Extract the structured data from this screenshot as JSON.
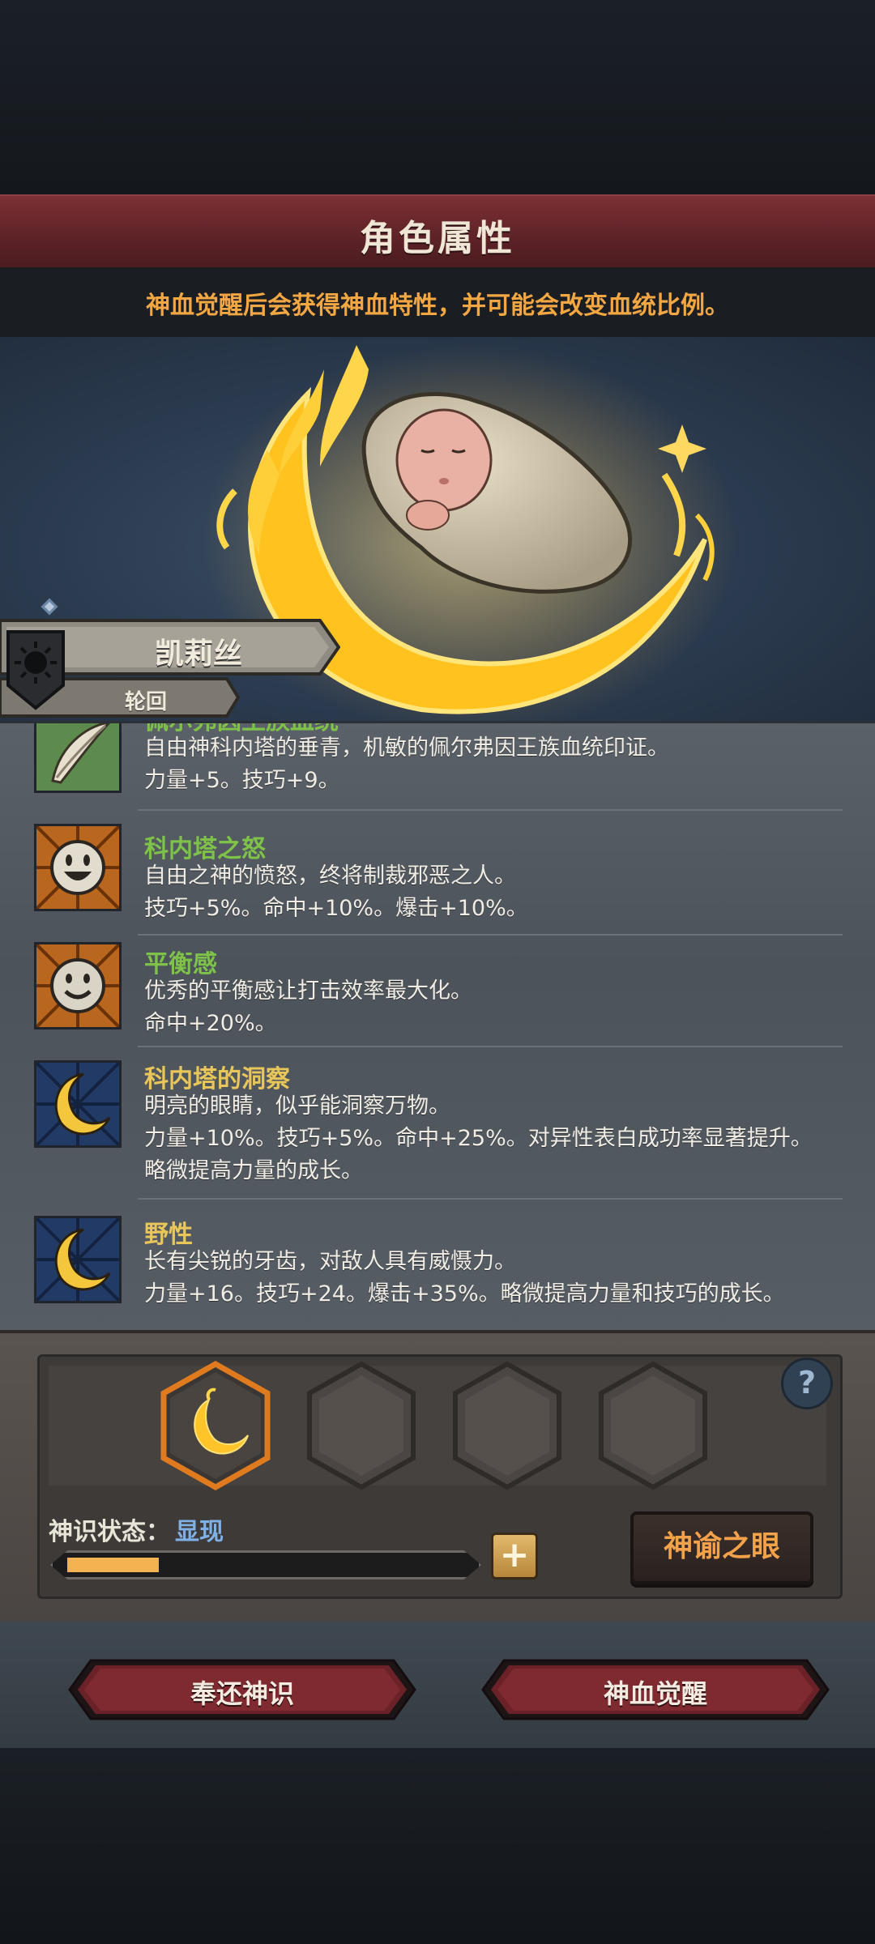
{
  "header": {
    "title": "角色属性"
  },
  "subtitle": "神血觉醒后会获得神血特性，并可能会改变血统比例。",
  "character": {
    "name": "凯莉丝",
    "subtitle": "轮回"
  },
  "traits": [
    {
      "name": "佩尔弗因王族血统",
      "icon": "feather-icon",
      "lines": [
        "自由神科内塔的垂青，机敏的佩尔弗因王族血统印证。",
        "力量+5。技巧+9。"
      ]
    },
    {
      "name": "科内塔之怒",
      "icon": "laughing-face-icon",
      "lines": [
        "自由之神的愤怒，终将制裁邪恶之人。",
        "技巧+5%。命中+10%。爆击+10%。"
      ]
    },
    {
      "name": "平衡感",
      "icon": "smiling-face-icon",
      "lines": [
        "优秀的平衡感让打击效率最大化。",
        "命中+20%。"
      ]
    },
    {
      "name": "科内塔的洞察",
      "icon": "crescent-moon-icon",
      "lines": [
        "明亮的眼睛，似乎能洞察万物。",
        "力量+10%。技巧+5%。命中+25%。对异性表白成功率显著提升。",
        "略微提高力量的成长。"
      ]
    },
    {
      "name": "野性",
      "icon": "crescent-moon-icon",
      "lines": [
        "长有尖锐的牙齿，对敌人具有威慑力。",
        "力量+16。技巧+24。爆击+35%。略微提高力量和技巧的成长。"
      ]
    }
  ],
  "slots": {
    "help": "?"
  },
  "status": {
    "label": "神识状态：",
    "value": "显现",
    "progress": 0.23
  },
  "buttons": {
    "oracle": "神谕之眼",
    "return": "奉还神识",
    "awaken": "神血觉醒"
  },
  "colors": {
    "trait_green": "#7ec24a",
    "trait_gold": "#e8c65a",
    "accent_orange": "#f3a743"
  }
}
